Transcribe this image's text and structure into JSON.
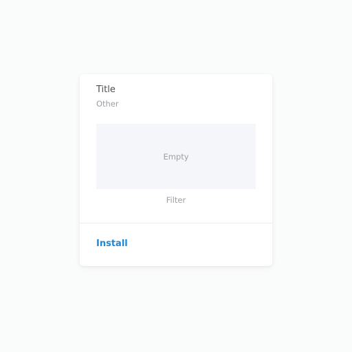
{
  "card": {
    "title": "Title",
    "subtitle": "Other",
    "preview_placeholder": "Empty",
    "caption": "Filter",
    "action_label": "Install"
  },
  "colors": {
    "accent": "#1f87d6",
    "background": "#fafbfb",
    "card": "#ffffff",
    "preview": "#f5f6f9"
  }
}
